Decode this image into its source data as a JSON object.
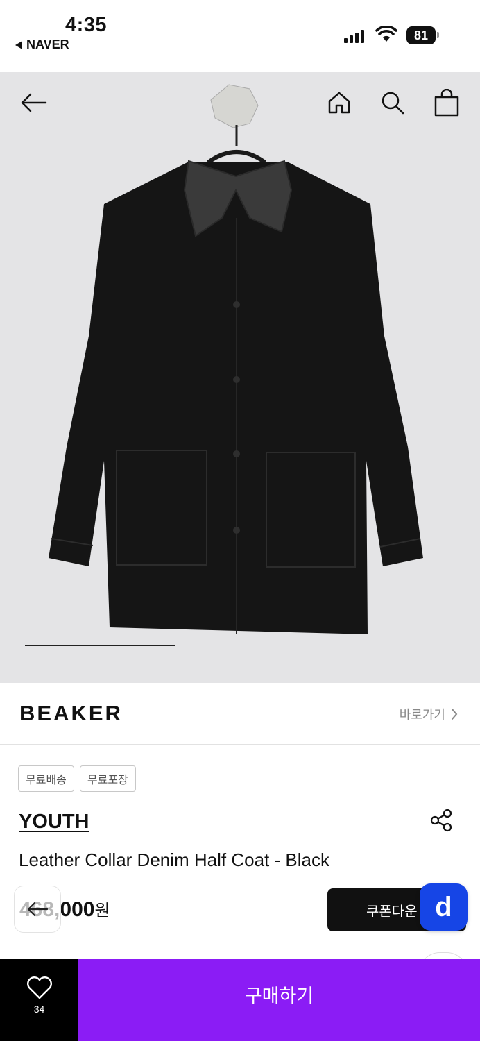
{
  "status_bar": {
    "time": "4:35",
    "back_app": "NAVER",
    "battery": "81"
  },
  "hero": {
    "icons": [
      "back-arrow-icon",
      "home-icon",
      "search-icon",
      "shopping-bag-icon"
    ],
    "image_progress": 0.35
  },
  "brand_bar": {
    "logo": "BEAKER",
    "link_label": "바로가기"
  },
  "tags": [
    "무료배송",
    "무료포장"
  ],
  "product": {
    "brand": "YOUTH",
    "name": "Leather Collar Denim Half Coat - Black",
    "price": "468,000",
    "currency": "원"
  },
  "coupon": {
    "label": "쿠폰다운",
    "badge": "d"
  },
  "bottom_bar": {
    "like_count": "34",
    "buy_label": "구매하기"
  },
  "colors": {
    "buy_button": "#8b1cf5",
    "badge": "#1645e6",
    "image_bg": "#e4e4e6"
  }
}
